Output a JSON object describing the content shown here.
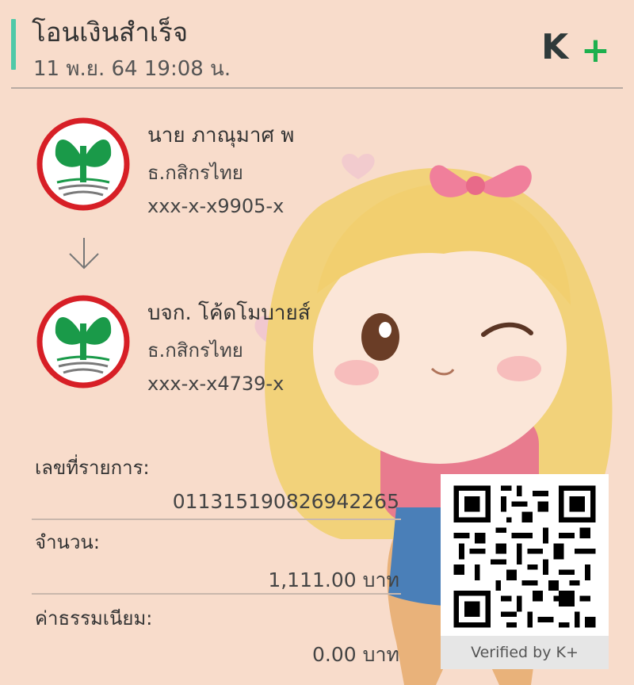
{
  "header": {
    "title": "โอนเงินสำเร็จ",
    "datetime": "11 พ.ย. 64  19:08 น.",
    "logo_text": "K+",
    "accent_color": "#4fc9a8"
  },
  "sender": {
    "name": "นาย ภาณุมาศ พ",
    "bank": "ธ.กสิกรไทย",
    "account": "xxx-x-x9905-x",
    "logo": "kasikorn-bank-logo"
  },
  "arrow_icon": "arrow-down-icon",
  "receiver": {
    "name": "บจก. โค้ดโมบายส์",
    "bank": "ธ.กสิกรไทย",
    "account": "xxx-x-x4739-x",
    "logo": "kasikorn-bank-logo"
  },
  "fields": {
    "ref_label": "เลขที่รายการ:",
    "ref_value": "011315190826942265",
    "amount_label": "จำนวน:",
    "amount_value": "1,111.00 บาท",
    "fee_label": "ค่าธรรมเนียม:",
    "fee_value": "0.00 บาท"
  },
  "qr": {
    "verified_text": "Verified by K+"
  },
  "colors": {
    "background": "#f8dccb",
    "kbank_green": "#1a9a49",
    "kbank_red": "#d71f26",
    "kplus_green": "#1cb04e"
  }
}
